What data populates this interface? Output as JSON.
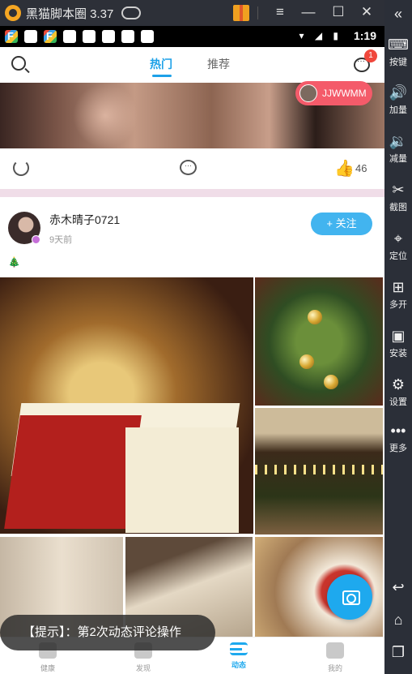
{
  "emulator": {
    "title": "黑猫脚本圈 3.37",
    "controls": [
      "≡",
      "—",
      "☐",
      "✕"
    ]
  },
  "status_bar": {
    "time": "1:19",
    "icons": "▾ ◢ ▮"
  },
  "sidebar": {
    "collapse": "«",
    "items": [
      {
        "icon": "⌨",
        "label": "按键"
      },
      {
        "icon": "🔊",
        "label": "加量"
      },
      {
        "icon": "🔉",
        "label": "减量"
      },
      {
        "icon": "✂",
        "label": "截图"
      },
      {
        "icon": "⌖",
        "label": "定位"
      },
      {
        "icon": "⊞",
        "label": "多开"
      },
      {
        "icon": "▣",
        "label": "安装"
      },
      {
        "icon": "⚙",
        "label": "设置"
      },
      {
        "icon": "•••",
        "label": "更多"
      }
    ],
    "nav": [
      "↩",
      "⌂",
      "❐"
    ]
  },
  "topnav": {
    "tabs": [
      {
        "label": "热门"
      },
      {
        "label": "推荐"
      }
    ],
    "message_badge": "1"
  },
  "post1": {
    "user_chip": "JJWWMM",
    "like_count": "46"
  },
  "post2": {
    "username": "赤木晴子0721",
    "time": "9天前",
    "follow_label": "+ 关注",
    "content": "🎄"
  },
  "bottom_nav": [
    {
      "label": "健康"
    },
    {
      "label": "发现"
    },
    {
      "label": "动态"
    },
    {
      "label": "我的"
    }
  ],
  "toast": "【提示】：第2次动态评论操作",
  "colors": {
    "accent": "#1da1e8",
    "badge": "#f0473c",
    "chip": "#f45b6a",
    "divider": "#f0dde8"
  }
}
